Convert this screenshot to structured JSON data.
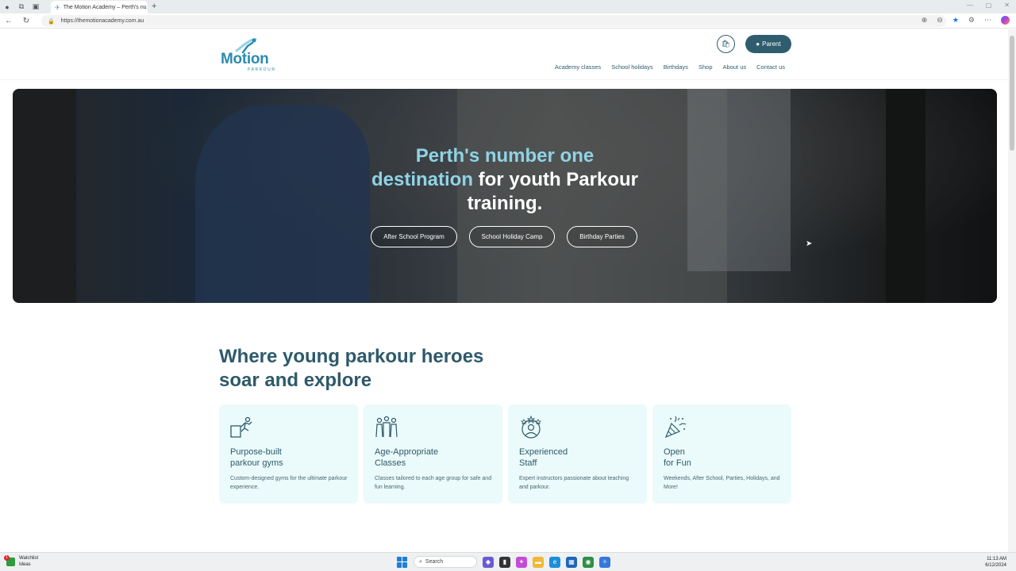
{
  "browser": {
    "tab_title": "The Motion Academy – Perth's nu",
    "url": "https://themotionacademy.com.au"
  },
  "header": {
    "logo_word": "Motion",
    "logo_sub": "PARKOUR",
    "parent_label": "Parent",
    "nav": [
      "Academy classes",
      "School holidays",
      "Birthdays",
      "Shop",
      "About us",
      "Contact us"
    ]
  },
  "hero": {
    "title_accent_1": "Perth's number one",
    "title_accent_2": "destination",
    "title_rest_1": " for youth Parkour",
    "title_rest_2": "training.",
    "buttons": [
      "After School Program",
      "School Holiday Camp",
      "Birthday Parties"
    ]
  },
  "section": {
    "title_line1": "Where young parkour heroes",
    "title_line2": "soar and explore"
  },
  "cards": [
    {
      "title_1": "Purpose-built",
      "title_2": "parkour gyms",
      "text": "Custom-designed gyms for the ultimate parkour experience.",
      "icon": "parkour-jump-icon"
    },
    {
      "title_1": "Age-Appropriate",
      "title_2": "Classes",
      "text": "Classes tailored to each age group for safe and fun learning.",
      "icon": "group-people-icon"
    },
    {
      "title_1": "Experienced",
      "title_2": "Staff",
      "text": "Expert instructors passionate about teaching and parkour.",
      "icon": "star-staff-icon"
    },
    {
      "title_1": "Open",
      "title_2": "for Fun",
      "text": "Weekends, After School, Parties, Holidays, and More!",
      "icon": "party-popper-icon"
    }
  ],
  "taskbar": {
    "watchlist": "Watchlist",
    "watchlist_sub": "Ideas",
    "badge": "1",
    "search": "Search",
    "time": "11:13 AM",
    "date": "6/12/2024"
  },
  "colors": {
    "brand": "#2f5d6e",
    "accent": "#8fd3e6",
    "card_bg": "#ebfafa"
  }
}
